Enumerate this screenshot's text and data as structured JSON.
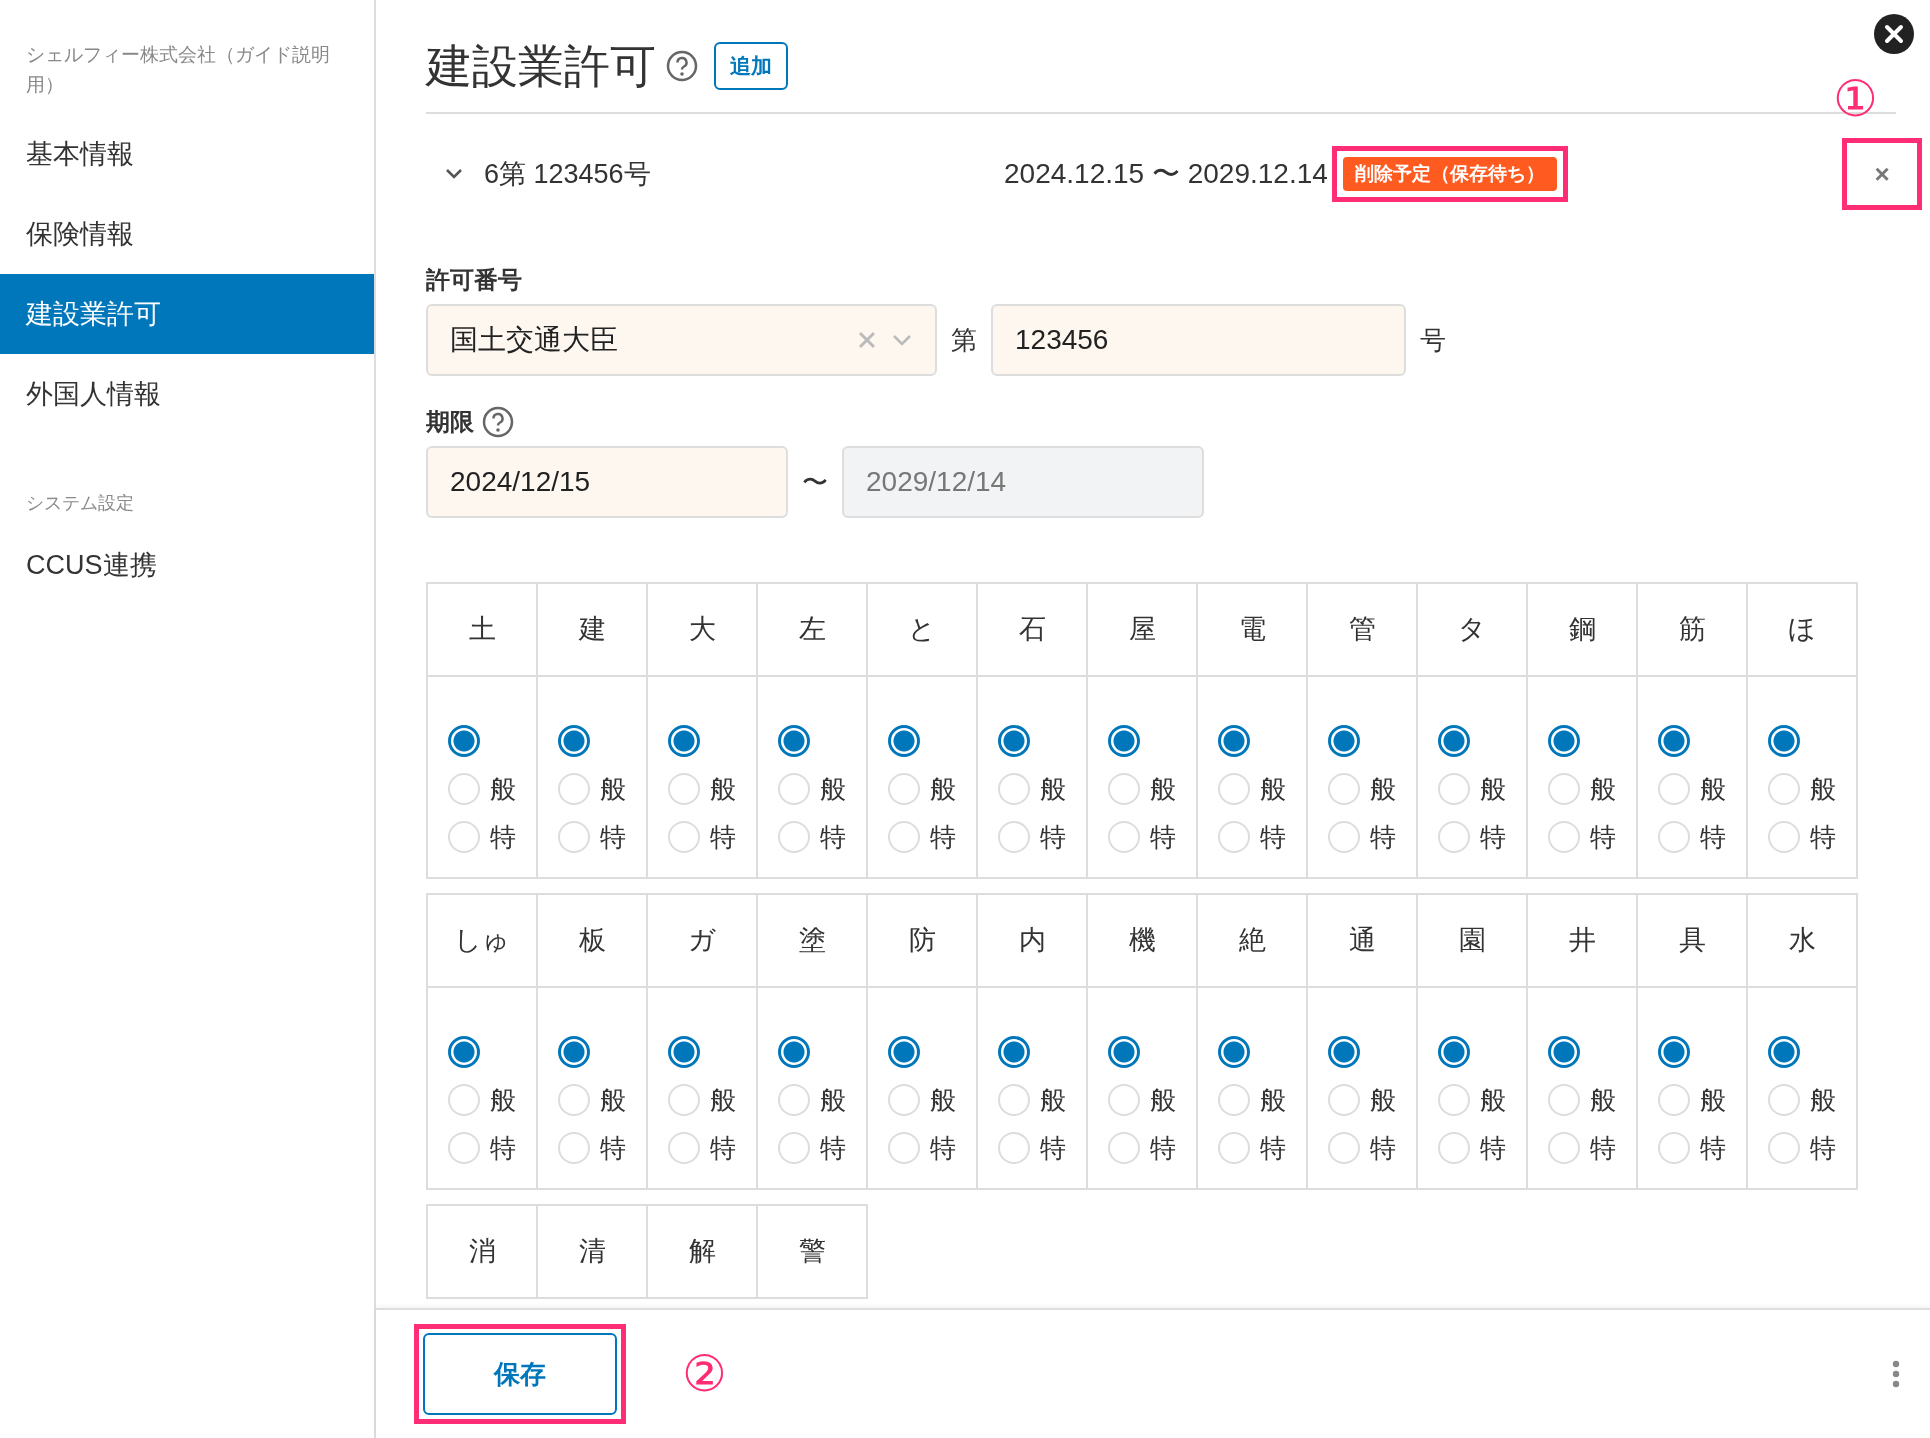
{
  "sidebar": {
    "company": "シェルフィー株式会社（ガイド説明用）",
    "items": [
      {
        "label": "基本情報",
        "selected": false
      },
      {
        "label": "保険情報",
        "selected": false
      },
      {
        "label": "建設業許可",
        "selected": true
      },
      {
        "label": "外国人情報",
        "selected": false
      }
    ],
    "section_title": "システム設定",
    "section_items": [
      {
        "label": "CCUS連携",
        "selected": false
      }
    ]
  },
  "header": {
    "title": "建設業許可",
    "add_button": "追加"
  },
  "permit_row": {
    "expanded": true,
    "number": "6第 123456号",
    "period": "2024.12.15 〜 2029.12.14",
    "badge": {
      "label": "削除予定（保存待ち）",
      "highlighted": true
    },
    "delete_button": {
      "label": "×",
      "highlighted": true
    },
    "annotation": "①"
  },
  "form": {
    "permit_number": {
      "label": "許可番号",
      "authority": "国土交通大臣",
      "prefix": "第",
      "number": "123456",
      "suffix": "号"
    },
    "period": {
      "label": "期限",
      "start": "2024/12/15",
      "separator": "〜",
      "end": "2029/12/14",
      "end_disabled": true
    }
  },
  "trades": [
    [
      {
        "label": "土",
        "options": [
          {
            "selected": true
          },
          {
            "label": "般",
            "selected": false
          },
          {
            "label": "特",
            "selected": false
          }
        ]
      },
      {
        "label": "建",
        "options": [
          {
            "selected": true
          },
          {
            "label": "般",
            "selected": false
          },
          {
            "label": "特",
            "selected": false
          }
        ]
      },
      {
        "label": "大",
        "options": [
          {
            "selected": true
          },
          {
            "label": "般",
            "selected": false
          },
          {
            "label": "特",
            "selected": false
          }
        ]
      },
      {
        "label": "左",
        "options": [
          {
            "selected": true
          },
          {
            "label": "般",
            "selected": false
          },
          {
            "label": "特",
            "selected": false
          }
        ]
      },
      {
        "label": "と",
        "options": [
          {
            "selected": true
          },
          {
            "label": "般",
            "selected": false
          },
          {
            "label": "特",
            "selected": false
          }
        ]
      },
      {
        "label": "石",
        "options": [
          {
            "selected": true
          },
          {
            "label": "般",
            "selected": false
          },
          {
            "label": "特",
            "selected": false
          }
        ]
      },
      {
        "label": "屋",
        "options": [
          {
            "selected": true
          },
          {
            "label": "般",
            "selected": false
          },
          {
            "label": "特",
            "selected": false
          }
        ]
      },
      {
        "label": "電",
        "options": [
          {
            "selected": true
          },
          {
            "label": "般",
            "selected": false
          },
          {
            "label": "特",
            "selected": false
          }
        ]
      },
      {
        "label": "管",
        "options": [
          {
            "selected": true
          },
          {
            "label": "般",
            "selected": false
          },
          {
            "label": "特",
            "selected": false
          }
        ]
      },
      {
        "label": "タ",
        "options": [
          {
            "selected": true
          },
          {
            "label": "般",
            "selected": false
          },
          {
            "label": "特",
            "selected": false
          }
        ]
      },
      {
        "label": "鋼",
        "options": [
          {
            "selected": true
          },
          {
            "label": "般",
            "selected": false
          },
          {
            "label": "特",
            "selected": false
          }
        ]
      },
      {
        "label": "筋",
        "options": [
          {
            "selected": true
          },
          {
            "label": "般",
            "selected": false
          },
          {
            "label": "特",
            "selected": false
          }
        ]
      },
      {
        "label": "ほ",
        "options": [
          {
            "selected": true
          },
          {
            "label": "般",
            "selected": false
          },
          {
            "label": "特",
            "selected": false
          }
        ]
      }
    ],
    [
      {
        "label": "しゅ",
        "options": [
          {
            "selected": true
          },
          {
            "label": "般",
            "selected": false
          },
          {
            "label": "特",
            "selected": false
          }
        ]
      },
      {
        "label": "板",
        "options": [
          {
            "selected": true
          },
          {
            "label": "般",
            "selected": false
          },
          {
            "label": "特",
            "selected": false
          }
        ]
      },
      {
        "label": "ガ",
        "options": [
          {
            "selected": true
          },
          {
            "label": "般",
            "selected": false
          },
          {
            "label": "特",
            "selected": false
          }
        ]
      },
      {
        "label": "塗",
        "options": [
          {
            "selected": true
          },
          {
            "label": "般",
            "selected": false
          },
          {
            "label": "特",
            "selected": false
          }
        ]
      },
      {
        "label": "防",
        "options": [
          {
            "selected": true
          },
          {
            "label": "般",
            "selected": false
          },
          {
            "label": "特",
            "selected": false
          }
        ]
      },
      {
        "label": "内",
        "options": [
          {
            "selected": true
          },
          {
            "label": "般",
            "selected": false
          },
          {
            "label": "特",
            "selected": false
          }
        ]
      },
      {
        "label": "機",
        "options": [
          {
            "selected": true
          },
          {
            "label": "般",
            "selected": false
          },
          {
            "label": "特",
            "selected": false
          }
        ]
      },
      {
        "label": "絶",
        "options": [
          {
            "selected": true
          },
          {
            "label": "般",
            "selected": false
          },
          {
            "label": "特",
            "selected": false
          }
        ]
      },
      {
        "label": "通",
        "options": [
          {
            "selected": true
          },
          {
            "label": "般",
            "selected": false
          },
          {
            "label": "特",
            "selected": false
          }
        ]
      },
      {
        "label": "園",
        "options": [
          {
            "selected": true
          },
          {
            "label": "般",
            "selected": false
          },
          {
            "label": "特",
            "selected": false
          }
        ]
      },
      {
        "label": "井",
        "options": [
          {
            "selected": true
          },
          {
            "label": "般",
            "selected": false
          },
          {
            "label": "特",
            "selected": false
          }
        ]
      },
      {
        "label": "具",
        "options": [
          {
            "selected": true
          },
          {
            "label": "般",
            "selected": false
          },
          {
            "label": "特",
            "selected": false
          }
        ]
      },
      {
        "label": "水",
        "options": [
          {
            "selected": true
          },
          {
            "label": "般",
            "selected": false
          },
          {
            "label": "特",
            "selected": false
          }
        ]
      }
    ],
    [
      {
        "label": "消"
      },
      {
        "label": "清"
      },
      {
        "label": "解"
      },
      {
        "label": "警"
      }
    ]
  ],
  "footer": {
    "save_button": {
      "label": "保存",
      "highlighted": true
    },
    "annotation": "②"
  }
}
